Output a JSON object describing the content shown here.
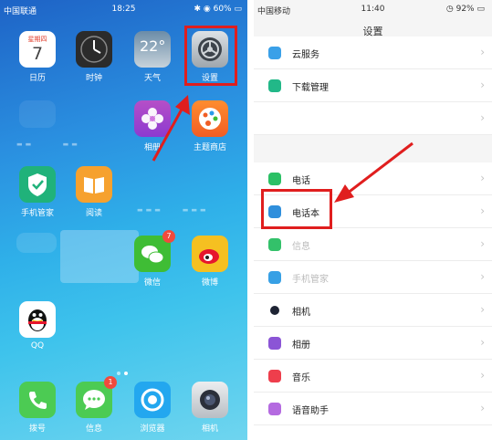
{
  "home": {
    "status": {
      "carrier": "中国联通",
      "time": "18:25",
      "battery": "60%"
    },
    "apps": {
      "calendar": {
        "label": "日历",
        "month": "星期四",
        "day": "7"
      },
      "clock": {
        "label": "时钟"
      },
      "weather": {
        "label": "天气",
        "temp": "22°"
      },
      "settings": {
        "label": "设置"
      },
      "photos": {
        "label": "相册"
      },
      "theme": {
        "label": "主题商店"
      },
      "phone_manager": {
        "label": "手机管家"
      },
      "reader": {
        "label": "阅读"
      },
      "wechat": {
        "label": "微信",
        "badge": "7"
      },
      "weibo": {
        "label": "微博"
      },
      "qq": {
        "label": "QQ"
      }
    },
    "dock": {
      "dialer": {
        "label": "拨号"
      },
      "messages": {
        "label": "信息",
        "badge": "1"
      },
      "browser": {
        "label": "浏览器"
      },
      "camera": {
        "label": "相机"
      }
    }
  },
  "settings": {
    "status": {
      "carrier": "中国移动",
      "time": "11:40",
      "battery": "92%"
    },
    "title": "设置",
    "items": {
      "cloud": "云服务",
      "download": "下载管理",
      "phone": "电话",
      "contacts": "电话本",
      "sms": "信息",
      "manager": "手机管家",
      "camera": "相机",
      "album": "相册",
      "music": "音乐",
      "voice": "语音助手"
    }
  },
  "colors": {
    "highlight": "#e01e1e"
  }
}
